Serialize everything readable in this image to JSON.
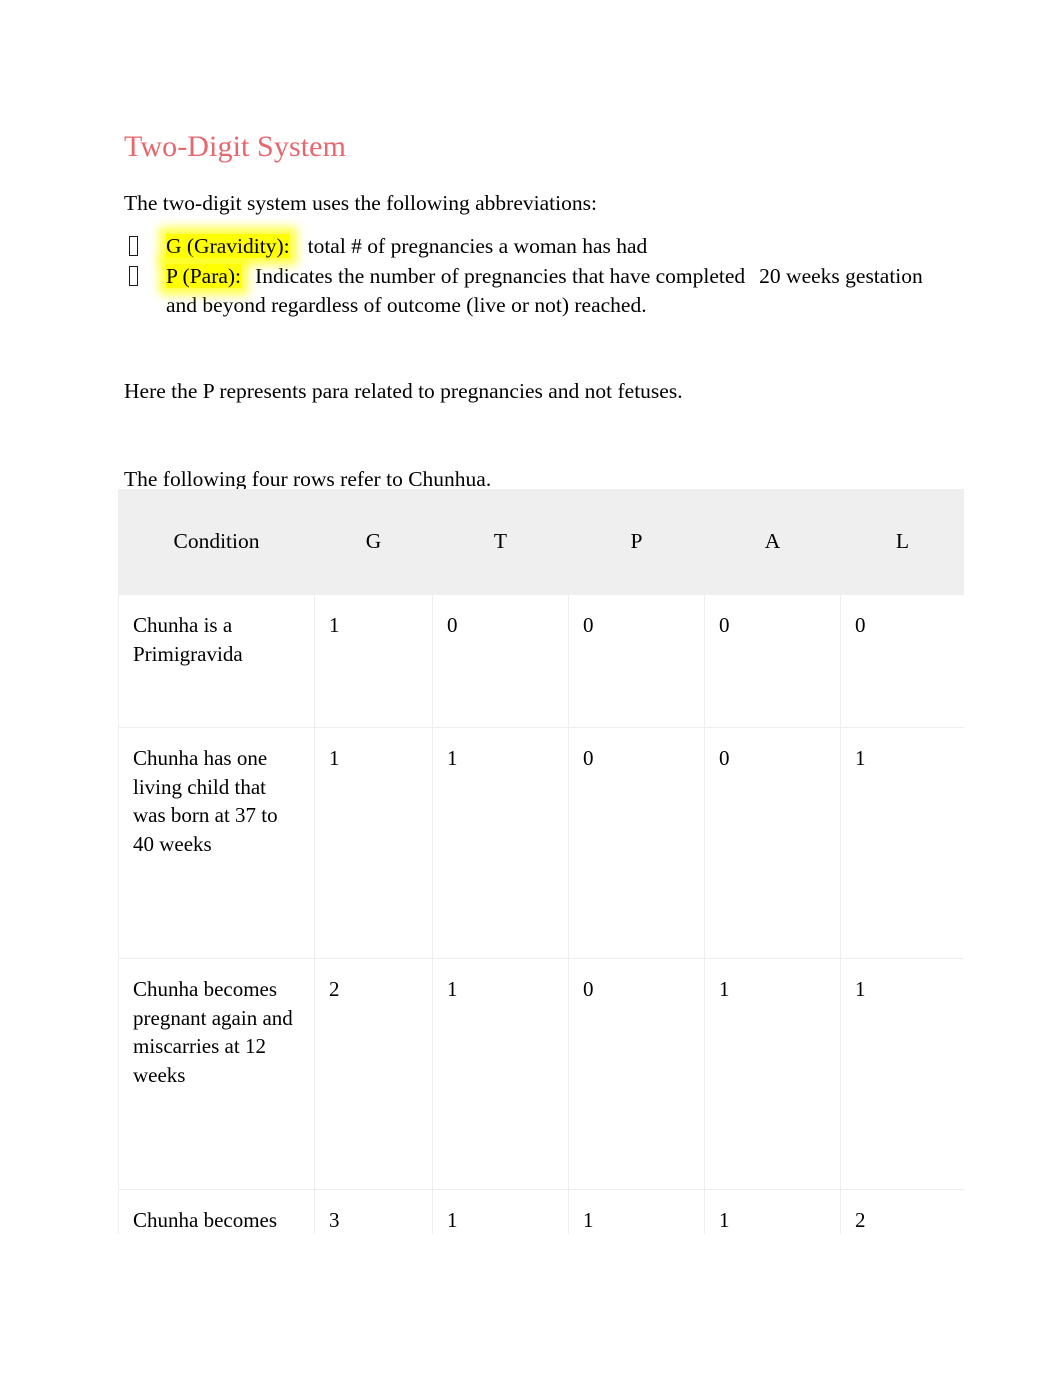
{
  "document": {
    "title": "Two-Digit System",
    "title_color": "#e8666d",
    "intro_paragraph": "The two-digit system uses the following abbreviations:",
    "bullets": [
      {
        "marker": "tofu-box-bullet",
        "highlighted_label": "G (Gravidity):",
        "text": "total # of pregnancies a woman has had"
      },
      {
        "marker": "tofu-box-bullet",
        "highlighted_label": "P (Para):",
        "text_part_1": "Indicates the number of pregnancies that have",
        "text_part_2": "completed",
        "text_part_3": "20 weeks gestation",
        "text_part_4": "and beyond regardless of outcome (live or not) reached."
      }
    ],
    "note_paragraph": "Here the P represents para related to pregnancies and not fetuses.",
    "table_intro": "The following four rows refer to Chunhua."
  },
  "table": {
    "headers": [
      "Condition",
      "G",
      "T",
      "P",
      "A",
      "L"
    ],
    "rows": [
      {
        "condition": "Chunha is a Primigravida",
        "G": "1",
        "T": "0",
        "P": "0",
        "A": "0",
        "L": "0"
      },
      {
        "condition": "Chunha has one living child that was born at 37 to 40 weeks",
        "G": "1",
        "T": "1",
        "P": "0",
        "A": "0",
        "L": "1"
      },
      {
        "condition": "Chunha becomes pregnant again and miscarries at 12 weeks",
        "G": "2",
        "T": "1",
        "P": "0",
        "A": "1",
        "L": "1"
      },
      {
        "condition": "Chunha becomes pregnant again",
        "G": "3",
        "T": "1",
        "P": "1",
        "A": "1",
        "L": "2"
      }
    ],
    "header_background": "#efefef",
    "border_color": "#eceff1"
  },
  "highlight_color": "#ffff00"
}
